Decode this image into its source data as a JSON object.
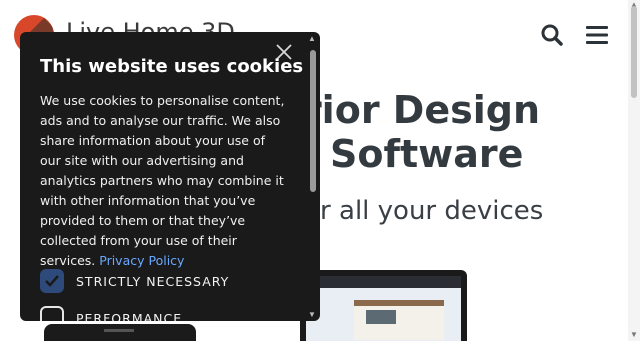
{
  "header": {
    "logo_text": "Live Home 3D",
    "search_icon": "search-icon",
    "menu_icon": "hamburger-menu-icon"
  },
  "hero": {
    "title_line1": "Interior Design",
    "title_line2": "Software",
    "subtitle": "for all your devices"
  },
  "cookie_dialog": {
    "title": "This website uses cookies",
    "body": "We use cookies to personalise content, ads and to analyse our traffic. We also share information about your use of our site with our advertising and analytics partners who may combine it with other information that you’ve provided to them or that they’ve collected from your use of their services. ",
    "privacy_link": "Privacy Policy",
    "options": [
      {
        "label": "STRICTLY NECESSARY",
        "checked": true
      },
      {
        "label": "PERFORMANCE",
        "checked": false
      }
    ]
  },
  "colors": {
    "dialog_bg": "#1a1a1a",
    "link": "#6aa7ff",
    "checkbox_checked": "#2d4a7a",
    "logo_accent": "#d9472b"
  }
}
